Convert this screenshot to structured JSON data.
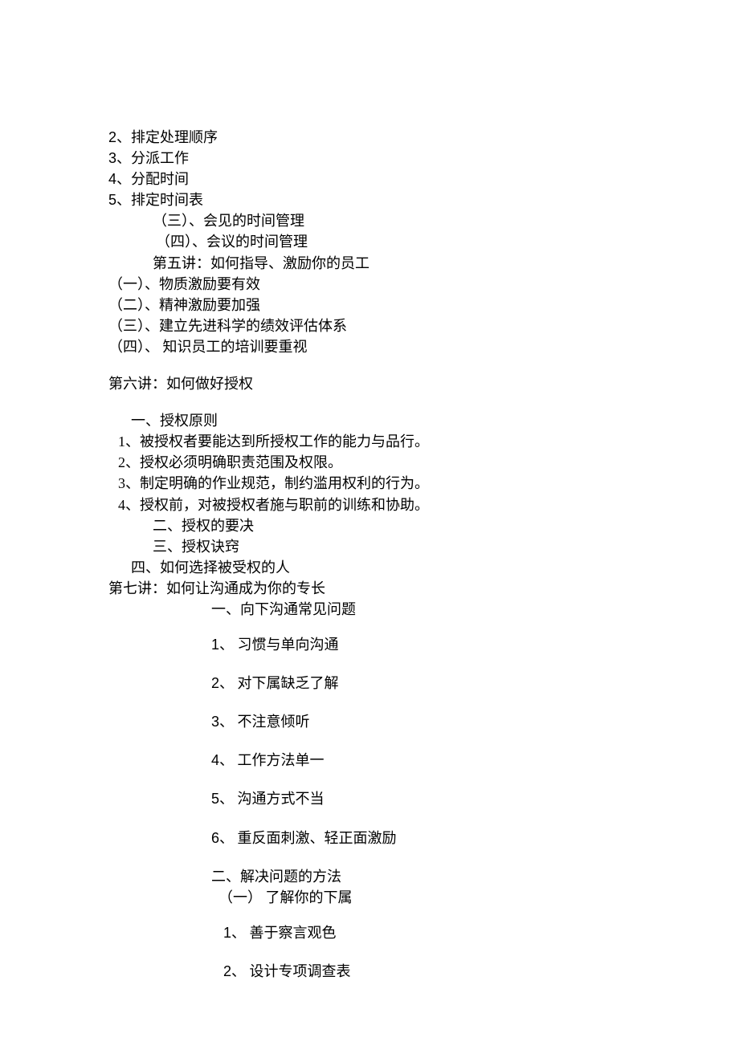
{
  "top_list": [
    {
      "num": "2、",
      "text": "排定处理顺序"
    },
    {
      "num": "3、",
      "text": "分派工作"
    },
    {
      "num": "4、",
      "text": "分配时间"
    },
    {
      "num": "5、",
      "text": "排定时间表"
    }
  ],
  "sub_san": "（三）、会见的时间管理",
  "sub_si": "（四）、会议的时间管理",
  "lecture5_title": "第五讲：如何指导、激励你的员工",
  "lecture5_items": [
    "（一）、物质激励要有效",
    "（二）、精神激励要加强",
    "（三）、建立先进科学的绩效评估体系",
    "（四）、 知识员工的培训要重视"
  ],
  "lecture6_title": "第六讲：如何做好授权",
  "lecture6_sec1_title": "一、授权原则",
  "lecture6_sec1_items": [
    "1、被授权者要能达到所授权工作的能力与品行。",
    "2、授权必须明确职责范围及权限。",
    "3、制定明确的作业规范，制约滥用权利的行为。",
    "4、授权前，对被授权者施与职前的训练和协助。"
  ],
  "lecture6_sec_others": [
    "二、授权的要决",
    "三、授权诀窍",
    "四、如何选择被受权的人"
  ],
  "lecture7_title": "第七讲：如何让沟通成为你的专长",
  "lecture7_sec1_title": "一、向下沟通常见问题",
  "lecture7_sec1_items": [
    {
      "num": "1、",
      "text": " 习惯与单向沟通"
    },
    {
      "num": "2、",
      "text": " 对下属缺乏了解"
    },
    {
      "num": "3、",
      "text": " 不注意倾听"
    },
    {
      "num": "4、",
      "text": " 工作方法单一"
    },
    {
      "num": "5、",
      "text": " 沟通方式不当"
    },
    {
      "num": "6、",
      "text": " 重反面刺激、轻正面激励"
    }
  ],
  "lecture7_sec2_title": "二、解决问题的方法",
  "lecture7_sec2_sub1": "（一）   了解你的下属",
  "lecture7_sec2_items": [
    {
      "num": "1、",
      "text": " 善于察言观色"
    },
    {
      "num": "2、",
      "text": " 设计专项调查表"
    }
  ]
}
